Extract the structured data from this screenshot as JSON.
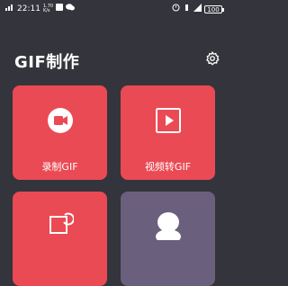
{
  "status_bar": {
    "time": "22:11",
    "speed_value": "1.70",
    "speed_unit": "K/s",
    "battery": "100"
  },
  "header": {
    "title": "GIF制作"
  },
  "tiles": [
    {
      "label": "录制GIF",
      "icon": "video-camera-icon"
    },
    {
      "label": "视频转GIF",
      "icon": "play-icon"
    },
    {
      "label": "",
      "icon": "convert-icon"
    },
    {
      "label": "",
      "icon": "sticker-figure-icon"
    }
  ],
  "colors": {
    "background": "#34343c",
    "tile_red": "#ea4a54",
    "tile_purple": "#6b5f7e"
  }
}
